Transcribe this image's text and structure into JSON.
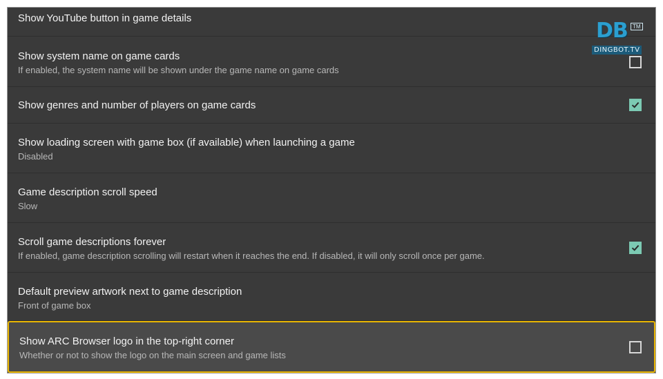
{
  "settings": [
    {
      "title": "Show YouTube button in game details",
      "description": "",
      "control": "none"
    },
    {
      "title": "Show system name on game cards",
      "description": "If enabled, the system name will be shown under the game name on game cards",
      "control": "checkbox",
      "checked": false
    },
    {
      "title": "Show genres and number of players on game cards",
      "description": "",
      "control": "checkbox",
      "checked": true
    },
    {
      "title": "Show loading screen with game box (if available) when launching a game",
      "description": "Disabled",
      "control": "none"
    },
    {
      "title": "Game description scroll speed",
      "description": "Slow",
      "control": "none"
    },
    {
      "title": "Scroll game descriptions forever",
      "description": "If enabled, game description scrolling will restart when it reaches the end. If disabled, it will only scroll once per game.",
      "control": "checkbox",
      "checked": true
    },
    {
      "title": "Default preview artwork next to game description",
      "description": "Front of game box",
      "control": "none"
    },
    {
      "title": "Show ARC Browser logo in the top-right corner",
      "description": "Whether or not to show the logo on the main screen and game lists",
      "control": "checkbox",
      "checked": false,
      "selected": true
    }
  ],
  "watermark": {
    "letters": "DB",
    "mark": "TM",
    "text": "DINGBOT.TV"
  },
  "colors": {
    "background": "#3a3a3a",
    "checkbox_checked": "#7ccab3",
    "selection_border": "#e9b600"
  }
}
